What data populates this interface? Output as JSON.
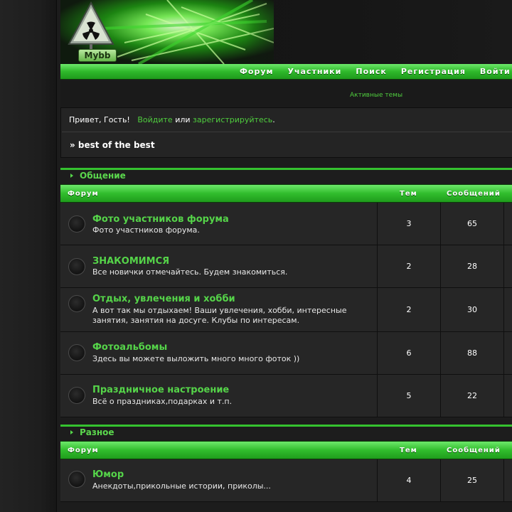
{
  "header": {
    "logo_text": "Mybb",
    "nav": [
      "Форум",
      "Участники",
      "Поиск",
      "Регистрация",
      "Войти"
    ],
    "active_topics": "Активные темы"
  },
  "welcome": {
    "greeting": "Привет, Гость!",
    "login_link": "Войдите",
    "or": "или",
    "register_link": "зарегистрируйтесь",
    "period": ".",
    "breadcrumb": "» best of the best"
  },
  "columns": {
    "forum": "Форум",
    "topics": "Тем",
    "posts": "Сообщений"
  },
  "categories": [
    {
      "title": "Общение",
      "forums": [
        {
          "title": "Фото участников форума",
          "desc": "Фото участников форума.",
          "topics": "3",
          "posts": "65"
        },
        {
          "title": "ЗНАКОМИМСЯ",
          "desc": "Все новички отмечайтесь. Будем знакомиться.",
          "topics": "2",
          "posts": "28"
        },
        {
          "title": "Отдых, увлечения и хобби",
          "desc": "А вот так мы отдыхаем! Ваши увлечения, хобби, интересные занятия, занятия на досуге. Клубы по интересам.",
          "topics": "2",
          "posts": "30"
        },
        {
          "title": "Фотоальбомы",
          "desc": "Здесь вы можете выложить много много фоток ))",
          "topics": "6",
          "posts": "88"
        },
        {
          "title": "Праздничное настроение",
          "desc": "Всё о праздниках,подарках и т.п.",
          "topics": "5",
          "posts": "22"
        }
      ]
    },
    {
      "title": "Разное",
      "forums": [
        {
          "title": "Юмор",
          "desc": "Анекдоты,прикольные истории, приколы...",
          "topics": "4",
          "posts": "25"
        }
      ]
    }
  ],
  "colors": {
    "accent": "#35c22f",
    "link": "#55d449",
    "background": "#1c1c1c"
  }
}
